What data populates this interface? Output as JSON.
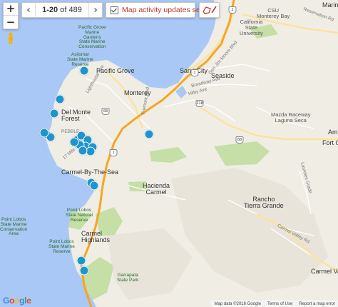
{
  "map": {
    "controls": {
      "zoom_in": "+",
      "zoom_out": "−"
    },
    "pagination": {
      "prev": "‹",
      "next": "›",
      "range": "1-20",
      "of_word": "of",
      "total": "489"
    },
    "activity_search": {
      "checked": true,
      "label": "Map activity updates search"
    },
    "places": {
      "pacific_grove": "Pacific Grove",
      "monterey": "Monterey",
      "del_monte_forest": "Del Monte\nForest",
      "carmel_by_the_sea": "Carmel-By-The-Sea",
      "hacienda_carmel": "Hacienda\nCarmel",
      "rancho_tierra_grande": "Rancho\nTierra Grande",
      "carmel_highlands": "Carmel\nHighlands",
      "carmel_valley": "Carmel Valle",
      "sand_city": "Sand City",
      "seaside": "Seaside",
      "marina": "Marin",
      "csu_monterey_bay": "CSU\nMonterey Bay",
      "california_state_university": "California\nState\nUniversity",
      "mazda_raceway": "Mazda Raceway\nLaguna Seca",
      "amb": "Amb",
      "fort_ord": "Fort O"
    },
    "parks": {
      "pacific_grove_gardens": "Pacific Grove\nMarine\nGardens\nState Marine\nConservation",
      "asilomar": "Asilomar\nState Marine\nReserve",
      "point_lobos_conservation": "Point Lobos\nState Marine\nConservation\nArea",
      "point_lobos_natural": "Point Lobos\nState Natural\nReserve",
      "point_lobos_reserve": "Point Lobos\nState Marine\nReserve",
      "garrapata": "Garrapata\nState Park"
    },
    "roads": {
      "lighthouse_ave": "Lighthouse Ave",
      "fremont_blvd": "Fremont Blvd",
      "broadway_ave": "Broadway Ave",
      "hilby_ave": "Hilby Ave",
      "gen_jim_moore": "Gen Jim Moore Blvd",
      "reservation_rd": "Reservation Rd",
      "laureles_grade": "Laureles Grade",
      "carmel_valley_rd": "Carmel Valley Rd",
      "pebble": "PEBBLE",
      "seventeen_mile": "17 Mile Dr"
    },
    "shields": {
      "hwy_1a": "1",
      "hwy_1b": "1",
      "hwy_1c": "1",
      "hwy_68a": "68",
      "hwy_68b": "68",
      "hwy_218": "218"
    },
    "listing_count_on_map": 20,
    "colors": {
      "water": "#a9c8f5",
      "land": "#f0ede5",
      "park": "#c5dfa6",
      "highway": "#f5a623",
      "marker": "#1e95cf",
      "activity_label": "#c0392b"
    },
    "footer": {
      "google": "Google",
      "map_data": "Map data ©2016 Google",
      "terms": "Terms of Use",
      "report": "Report a map error"
    }
  }
}
